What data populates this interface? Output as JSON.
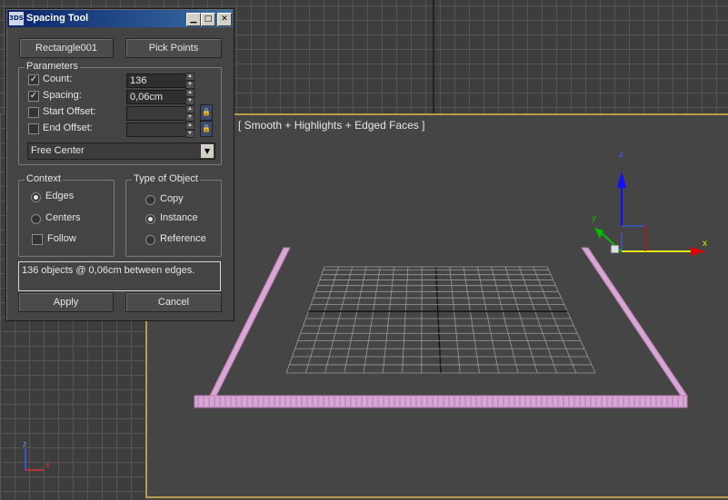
{
  "dialog": {
    "title": "Spacing Tool",
    "app_icon_text": "3DS",
    "titlebar_buttons": {
      "minimize": "▁",
      "maximize": "□",
      "close": "✕"
    },
    "path_button": "Rectangle001",
    "pick_points_button": "Pick Points",
    "parameters": {
      "legend": "Parameters",
      "count": {
        "label": "Count:",
        "checked": true,
        "value": "136"
      },
      "spacing": {
        "label": "Spacing:",
        "checked": true,
        "value": "0,06cm"
      },
      "start_offset": {
        "label": "Start Offset:",
        "checked": false,
        "value": ""
      },
      "end_offset": {
        "label": "End Offset:",
        "checked": false,
        "value": ""
      },
      "distribution": "Free Center"
    },
    "context": {
      "legend": "Context",
      "edges": "Edges",
      "centers": "Centers",
      "follow": "Follow",
      "selected": "Edges"
    },
    "type_of_object": {
      "legend": "Type of Object",
      "copy": "Copy",
      "instance": "Instance",
      "reference": "Reference",
      "selected": "Instance"
    },
    "status_text": "136 objects @ 0,06cm  between edges.",
    "apply_button": "Apply",
    "cancel_button": "Cancel"
  },
  "viewport": {
    "label": "[ Smooth + Highlights + Edged Faces ]",
    "gizmo": {
      "x": "x",
      "y": "y",
      "z": "z"
    },
    "axis_tripod": {
      "z": "z",
      "x": "x"
    }
  },
  "colors": {
    "object": "#d9a8d6",
    "frame": "#b89c4a",
    "titlebar": "#0a246a",
    "gizmo_x": "#e00000",
    "gizmo_y": "#00c000",
    "gizmo_z": "#1010ff"
  }
}
